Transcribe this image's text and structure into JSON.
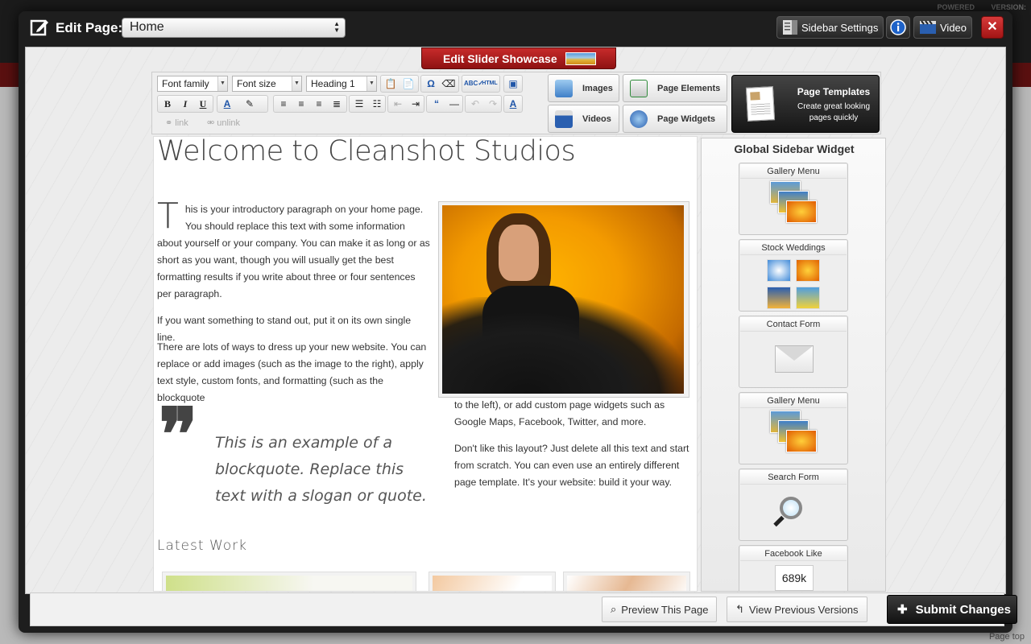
{
  "background": {
    "powered": "POWERED",
    "version": "VERSION:",
    "page_top": "Page top"
  },
  "titlebar": {
    "label": "Edit Page:",
    "page_value": "Home",
    "sidebar_settings": "Sidebar Settings",
    "video": "Video",
    "close": "✕"
  },
  "slider": {
    "label": "Edit Slider Showcase"
  },
  "toolbar": {
    "font_family": "Font family",
    "font_size": "Font size",
    "format": "Heading 1",
    "link": "link",
    "unlink": "unlink",
    "images": "Images",
    "videos": "Videos",
    "page_elements": "Page Elements",
    "page_widgets": "Page Widgets",
    "templates_title": "Page Templates",
    "templates_sub": "Create great looking pages quickly"
  },
  "content": {
    "heading": "Welcome to Cleanshot Studios",
    "dropcap": "T",
    "p1": "his is your introductory paragraph on your home page. You should replace this text with some information about yourself or your company. You can make it as long or as short as you want, though you will usually get the best formatting results if you write about three or four sentences per paragraph.",
    "p2": "If you want something to stand out, put it on its own single line.",
    "p3": "There are lots of ways to dress up your new website. You can replace or add images (such as the image to the right),  apply text style, custom fonts, and formatting (such as the blockquote",
    "p3_cont": "to the left),  or add custom page widgets such as Google Maps, Facebook, Twitter, and more.",
    "p4": "Don't like this layout? Just delete all this text and start from scratch.  You can even use an entirely different page template. It's your website: build it your way.",
    "quote_mark": "❞",
    "quote": "This is an example of a blockquote. Replace this text with a slogan or quote.",
    "latest": "Latest Work"
  },
  "sidebar": {
    "title": "Global Sidebar Widget",
    "widgets": [
      {
        "label": "Gallery Menu"
      },
      {
        "label": "Stock Weddings"
      },
      {
        "label": "Contact Form"
      },
      {
        "label": "Gallery Menu"
      },
      {
        "label": "Search Form"
      },
      {
        "label": "Facebook Like",
        "count": "689k"
      }
    ]
  },
  "footer": {
    "preview": "Preview This Page",
    "versions": "View Previous Versions",
    "submit": "Submit Changes"
  }
}
